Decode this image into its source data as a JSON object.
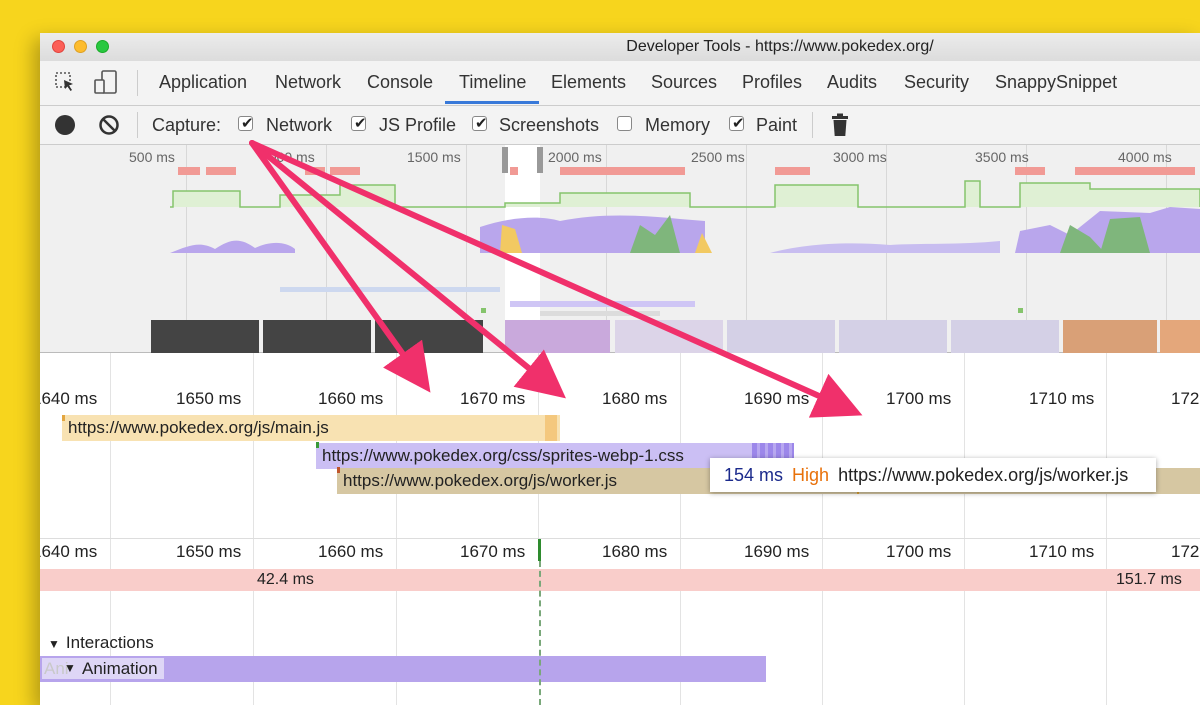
{
  "window": {
    "title": "Developer Tools - https://www.pokedex.org/"
  },
  "tabs": [
    "Application",
    "Network",
    "Console",
    "Timeline",
    "Elements",
    "Sources",
    "Profiles",
    "Audits",
    "Security",
    "SnappySnippet"
  ],
  "active_tab": "Timeline",
  "toolbar": {
    "capture_label": "Capture:",
    "checkboxes": [
      {
        "label": "Network",
        "checked": true
      },
      {
        "label": "JS Profile",
        "checked": true
      },
      {
        "label": "Screenshots",
        "checked": true
      },
      {
        "label": "Memory",
        "checked": false
      },
      {
        "label": "Paint",
        "checked": true
      }
    ]
  },
  "overview": {
    "ticks": [
      "500 ms",
      "1000 ms",
      "1500 ms",
      "2000 ms",
      "2500 ms",
      "3000 ms",
      "3500 ms",
      "4000 ms"
    ]
  },
  "ruler": {
    "ticks": [
      "1640 ms",
      "1650 ms",
      "1660 ms",
      "1670 ms",
      "1680 ms",
      "1690 ms",
      "1700 ms",
      "1710 ms",
      "172"
    ]
  },
  "network_rows": [
    {
      "url": "https://www.pokedex.org/js/main.js",
      "color": "#f8e2b2"
    },
    {
      "url": "https://www.pokedex.org/css/sprites-webp-1.css",
      "color": "#cbbff4"
    },
    {
      "url": "https://www.pokedex.org/js/worker.js",
      "color": "#d6c7a2"
    }
  ],
  "tooltip": {
    "duration": "154 ms",
    "priority": "High",
    "url": "https://www.pokedex.org/js/worker.js"
  },
  "frames": {
    "left": "42.4 ms",
    "right": "151.7 ms"
  },
  "interactions": {
    "title": "Interactions",
    "animation_label": "Animation",
    "faded_label": "Ani"
  },
  "colors": {
    "accent": "#3879d9",
    "priority_high": "#e8710a",
    "duration": "#1b2a8c",
    "arrow": "#f0306b"
  }
}
